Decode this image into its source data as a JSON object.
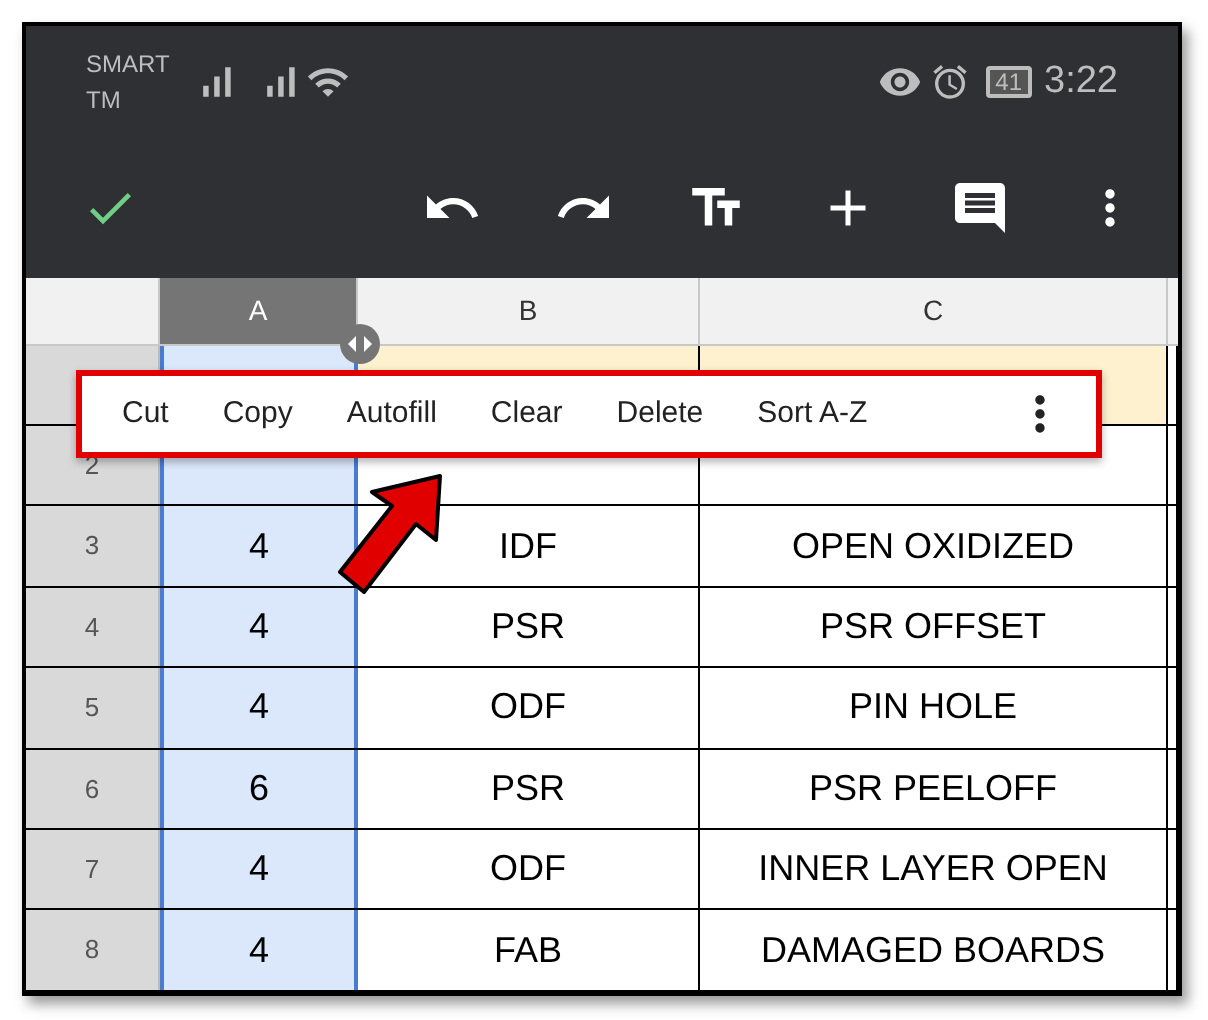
{
  "status_bar": {
    "carrier": [
      "SMART",
      "TM"
    ],
    "battery": "41",
    "time": "3:22"
  },
  "columns": [
    {
      "label": "A",
      "selected": true
    },
    {
      "label": "B",
      "selected": false
    },
    {
      "label": "C",
      "selected": false
    }
  ],
  "rows": [
    {
      "number": "2"
    },
    {
      "number": "3",
      "cells": [
        "4",
        "IDF",
        "OPEN OXIDIZED"
      ]
    },
    {
      "number": "4",
      "cells": [
        "4",
        "PSR",
        "PSR OFFSET"
      ]
    },
    {
      "number": "5",
      "cells": [
        "4",
        "ODF",
        "PIN HOLE"
      ]
    },
    {
      "number": "6",
      "cells": [
        "6",
        "PSR",
        "PSR PEELOFF"
      ]
    },
    {
      "number": "7",
      "cells": [
        "4",
        "ODF",
        "INNER LAYER OPEN"
      ]
    },
    {
      "number": "8",
      "cells": [
        "4",
        "FAB",
        "DAMAGED BOARDS"
      ]
    }
  ],
  "context_menu": {
    "items": [
      "Cut",
      "Copy",
      "Autofill",
      "Clear",
      "Delete",
      "Sort A-Z"
    ]
  }
}
